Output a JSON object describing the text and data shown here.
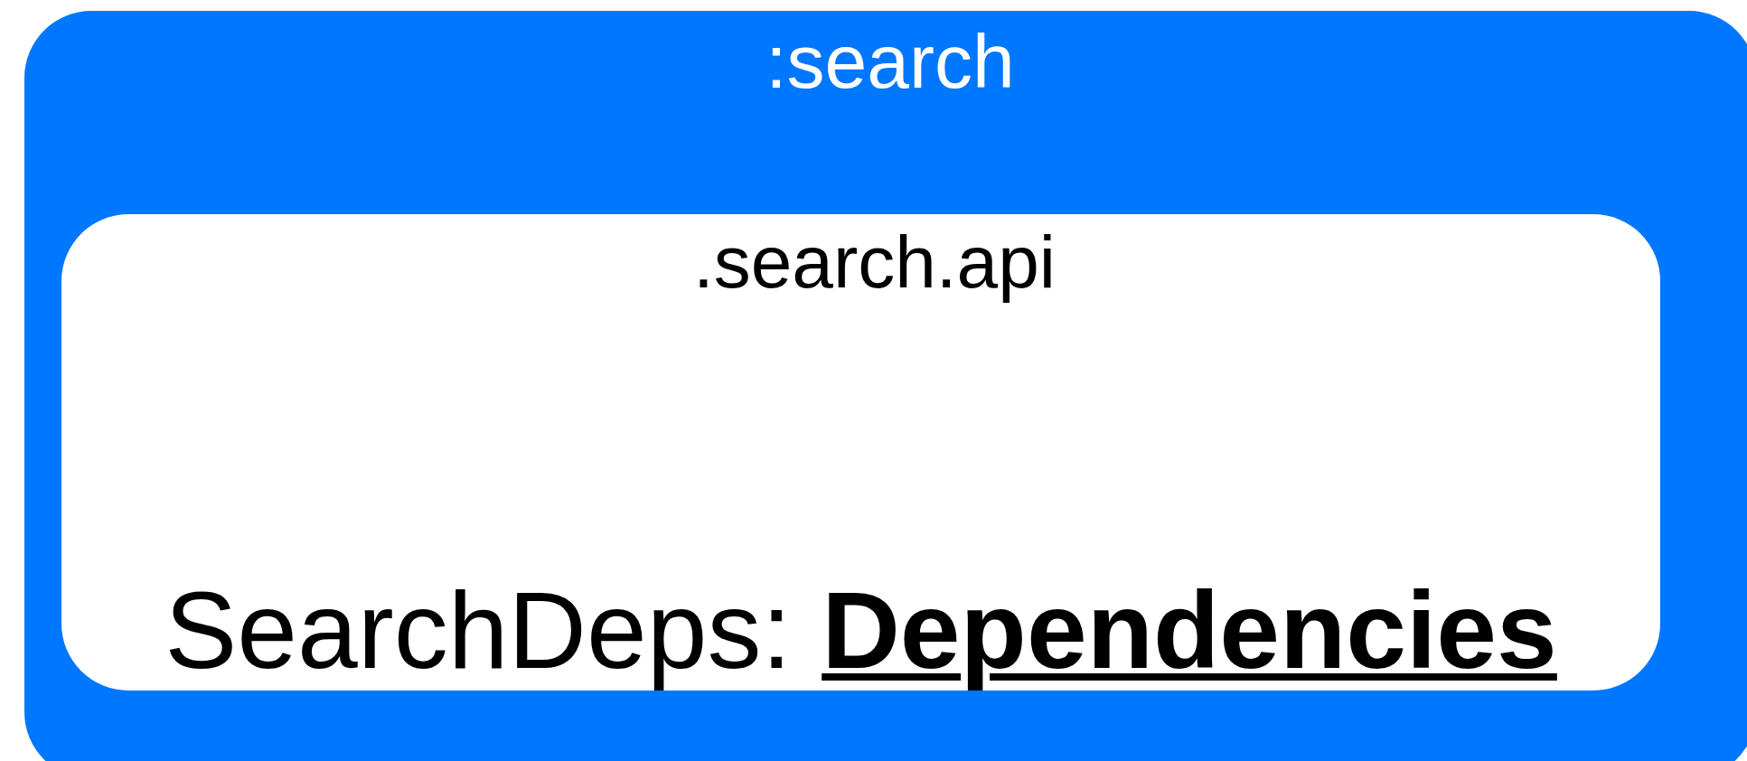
{
  "package": {
    "title": ":search",
    "module": {
      "title": ".search.api",
      "declaration": "SearchDeps: **Dependencies**"
    }
  }
}
